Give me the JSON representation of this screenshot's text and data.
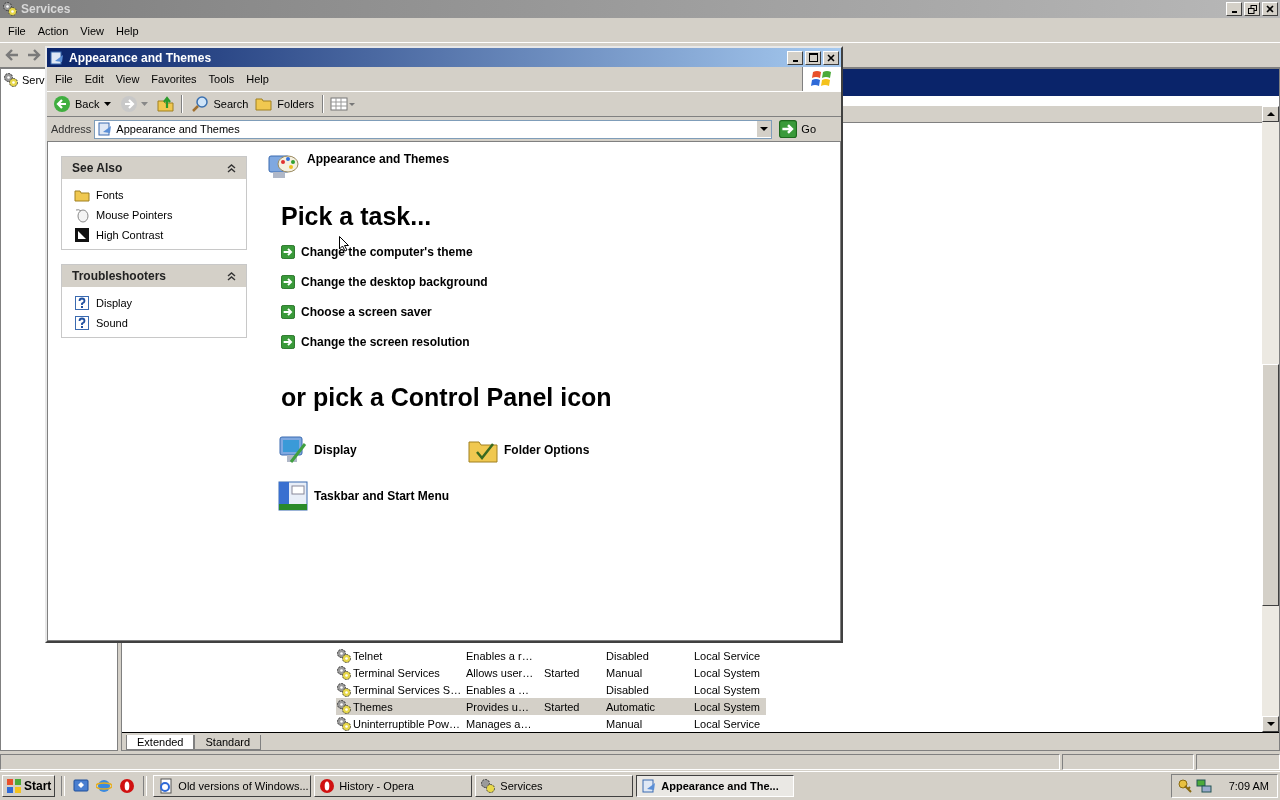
{
  "services_window": {
    "title": "Services",
    "menu": [
      "File",
      "Action",
      "View",
      "Help"
    ],
    "tree": [
      {
        "label": "Serv",
        "selected": false
      }
    ],
    "rows": [
      {
        "name": "Telnet",
        "description": "Enables a r…",
        "status": "",
        "startup": "Disabled",
        "log_on_as": "Local Service",
        "selected": false
      },
      {
        "name": "Terminal Services",
        "description": "Allows user…",
        "status": "Started",
        "startup": "Manual",
        "log_on_as": "Local System",
        "selected": false
      },
      {
        "name": "Terminal Services S…",
        "description": "Enables a …",
        "status": "",
        "startup": "Disabled",
        "log_on_as": "Local System",
        "selected": false
      },
      {
        "name": "Themes",
        "description": "Provides u…",
        "status": "Started",
        "startup": "Automatic",
        "log_on_as": "Local System",
        "selected": true
      },
      {
        "name": "Uninterruptible Pow…",
        "description": "Manages a…",
        "status": "",
        "startup": "Manual",
        "log_on_as": "Local Service",
        "selected": false
      }
    ],
    "tabs": [
      {
        "label": "Extended",
        "selected": true
      },
      {
        "label": "Standard",
        "selected": false
      }
    ]
  },
  "explorer_window": {
    "title": "Appearance and Themes",
    "menu": [
      "File",
      "Edit",
      "View",
      "Favorites",
      "Tools",
      "Help"
    ],
    "toolbar": {
      "back": "Back",
      "search": "Search",
      "folders": "Folders"
    },
    "address": {
      "label": "Address",
      "value": "Appearance and Themes",
      "go": "Go"
    },
    "side_panels": [
      {
        "title": "See Also",
        "items": [
          {
            "label": "Fonts",
            "kind": "folder"
          },
          {
            "label": "Mouse Pointers",
            "kind": "mouse"
          },
          {
            "label": "High Contrast",
            "kind": "contrast"
          }
        ]
      },
      {
        "title": "Troubleshooters",
        "items": [
          {
            "label": "Display",
            "kind": "help"
          },
          {
            "label": "Sound",
            "kind": "help"
          }
        ]
      }
    ],
    "heading": "Appearance and Themes",
    "task_heading": "Pick a task...",
    "tasks": [
      "Change the computer's theme",
      "Change the desktop background",
      "Choose a screen saver",
      "Change the screen resolution"
    ],
    "icon_heading": "or pick a Control Panel icon",
    "icons": [
      {
        "label": "Display",
        "kind": "display"
      },
      {
        "label": "Folder Options",
        "kind": "folder"
      },
      {
        "label": "Taskbar and Start Menu",
        "kind": "taskbar"
      }
    ]
  },
  "taskbar": {
    "start": "Start",
    "buttons": [
      {
        "label": "Old versions of Windows...",
        "kind": "document",
        "selected": false
      },
      {
        "label": "History - Opera",
        "kind": "opera",
        "selected": false
      },
      {
        "label": "Services",
        "kind": "gears",
        "selected": false
      },
      {
        "label": "Appearance and The...",
        "kind": "control-panel",
        "selected": true
      }
    ],
    "clock": "7:09 AM"
  }
}
